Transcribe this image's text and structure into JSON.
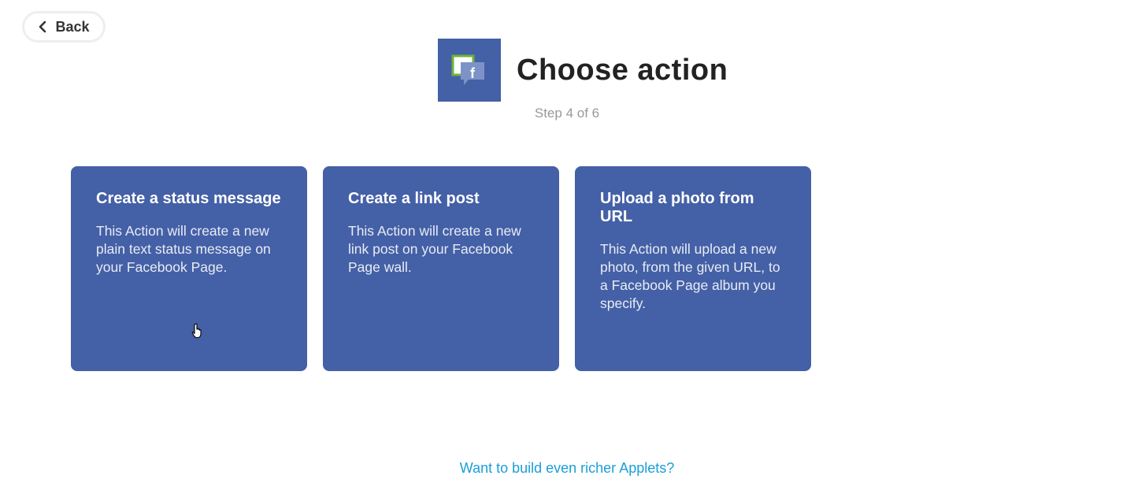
{
  "nav": {
    "back_label": "Back"
  },
  "header": {
    "title": "Choose action",
    "step": "Step 4 of 6",
    "service_icon": "facebook-pages-icon"
  },
  "actions": [
    {
      "title": "Create a status message",
      "description": "This Action will create a new plain text status message on your Facebook Page."
    },
    {
      "title": "Create a link post",
      "description": "This Action will create a new link post on your Facebook Page wall."
    },
    {
      "title": "Upload a photo from URL",
      "description": "This Action will upload a new photo, from the given URL, to a Facebook Page album you specify."
    }
  ],
  "footer": {
    "link_label": "Want to build even richer Applets?"
  },
  "colors": {
    "brand": "#4460a6",
    "link": "#1a9ed9",
    "muted": "#999999"
  }
}
